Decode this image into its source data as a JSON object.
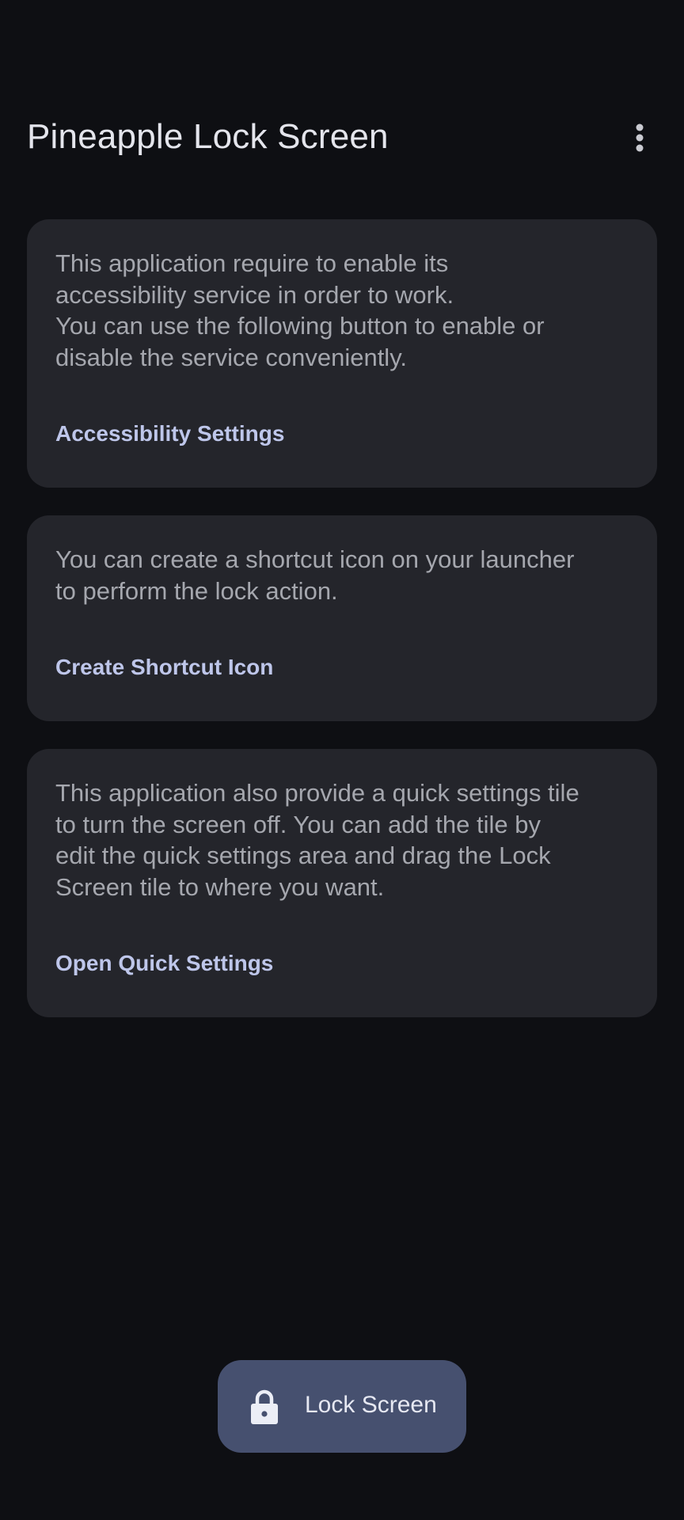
{
  "app_bar": {
    "title": "Pineapple Lock Screen",
    "overflow_icon": "more-vert-icon"
  },
  "cards": [
    {
      "text": "This application require to enable its\naccessibility service in order to work.\nYou can use the following button to enable or\ndisable the service conveniently.",
      "action": "Accessibility Settings"
    },
    {
      "text": "You can create a shortcut icon on your launcher\nto perform the lock action.",
      "action": "Create Shortcut Icon"
    },
    {
      "text": "This application also provide a quick settings tile\nto turn the screen off. You can add the tile by\nedit the quick settings area and drag the Lock\nScreen tile to where you want.",
      "action": "Open Quick Settings"
    }
  ],
  "fab": {
    "icon": "lock-icon",
    "label": "Lock Screen"
  },
  "colors": {
    "background": "#0e0f13",
    "card": "#24252b",
    "accent_text": "#bec6ea",
    "fab": "#46506f"
  }
}
